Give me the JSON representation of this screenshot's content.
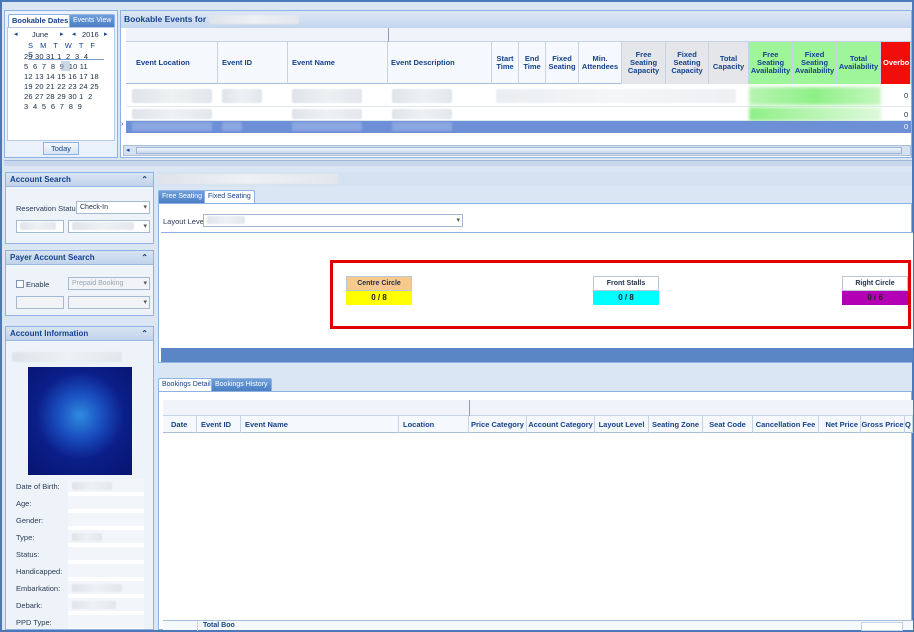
{
  "calendar": {
    "tab_dates": "Bookable Dates",
    "tab_events": "Events View",
    "month": "June",
    "year": "2016",
    "weekday_header": "S M T W T F S",
    "rows": [
      "29 30 31 1  2  3  4",
      "5  6  7  8  9  10 11",
      "12 13 14 15 16 17 18",
      "19 20 21 22 23 24 25",
      "26 27 28 29 30 1  2",
      "3  4  5  6  7  8  9"
    ],
    "selected_day": "8",
    "today_button": "Today"
  },
  "events": {
    "title": "Bookable Events for",
    "columns": [
      "Event Location",
      "Event ID",
      "Event Name",
      "Event Description",
      "Start Time",
      "End Time",
      "Fixed Seating",
      "Min. Attendees",
      "Free Seating Capacity",
      "Fixed Seating Capacity",
      "Total Capacity",
      "Free Seating Availability",
      "Fixed Seating Availability",
      "Total Availability",
      "Overbo"
    ],
    "overflow_values": [
      "0",
      "0",
      "0"
    ]
  },
  "account_search": {
    "title": "Account Search",
    "reservation_status_label": "Reservation Status:",
    "reservation_status_value": "Check-In"
  },
  "payer_search": {
    "title": "Payer Account Search",
    "enable_label": "Enable",
    "booking_placeholder": "Prepaid Booking"
  },
  "account_info": {
    "title": "Account Information",
    "fields": [
      "Date of Birth:",
      "Age:",
      "Gender:",
      "Type:",
      "Status:",
      "Handicapped:",
      "Embarkation:",
      "Debark:",
      "PPD Type:"
    ]
  },
  "seating": {
    "tab_free": "Free Seating",
    "tab_fixed": "Fixed Seating",
    "layout_label": "Layout Level:",
    "zones": [
      {
        "name": "Centre Circle",
        "count": "0 / 8",
        "head_color": "#f7c98d",
        "count_color": "#ffff00"
      },
      {
        "name": "Front Stalls",
        "count": "0 / 8",
        "head_color": "#ffffff",
        "count_color": "#00ffff"
      },
      {
        "name": "Right Circle",
        "count": "0 / 6",
        "head_color": "#ffffff",
        "count_color": "#b400b4"
      }
    ],
    "highlight_color": "#e00000"
  },
  "bookings": {
    "tab_details": "Bookings Details",
    "tab_history": "Bookings History",
    "columns": [
      "Date",
      "Event ID",
      "Event Name",
      "Location",
      "Price Category",
      "Account Category",
      "Layout Level",
      "Seating Zone",
      "Seat Code",
      "Cancellation Fee",
      "Net Price",
      "Gross Price",
      "Q"
    ],
    "total_label": "Total Boo"
  }
}
